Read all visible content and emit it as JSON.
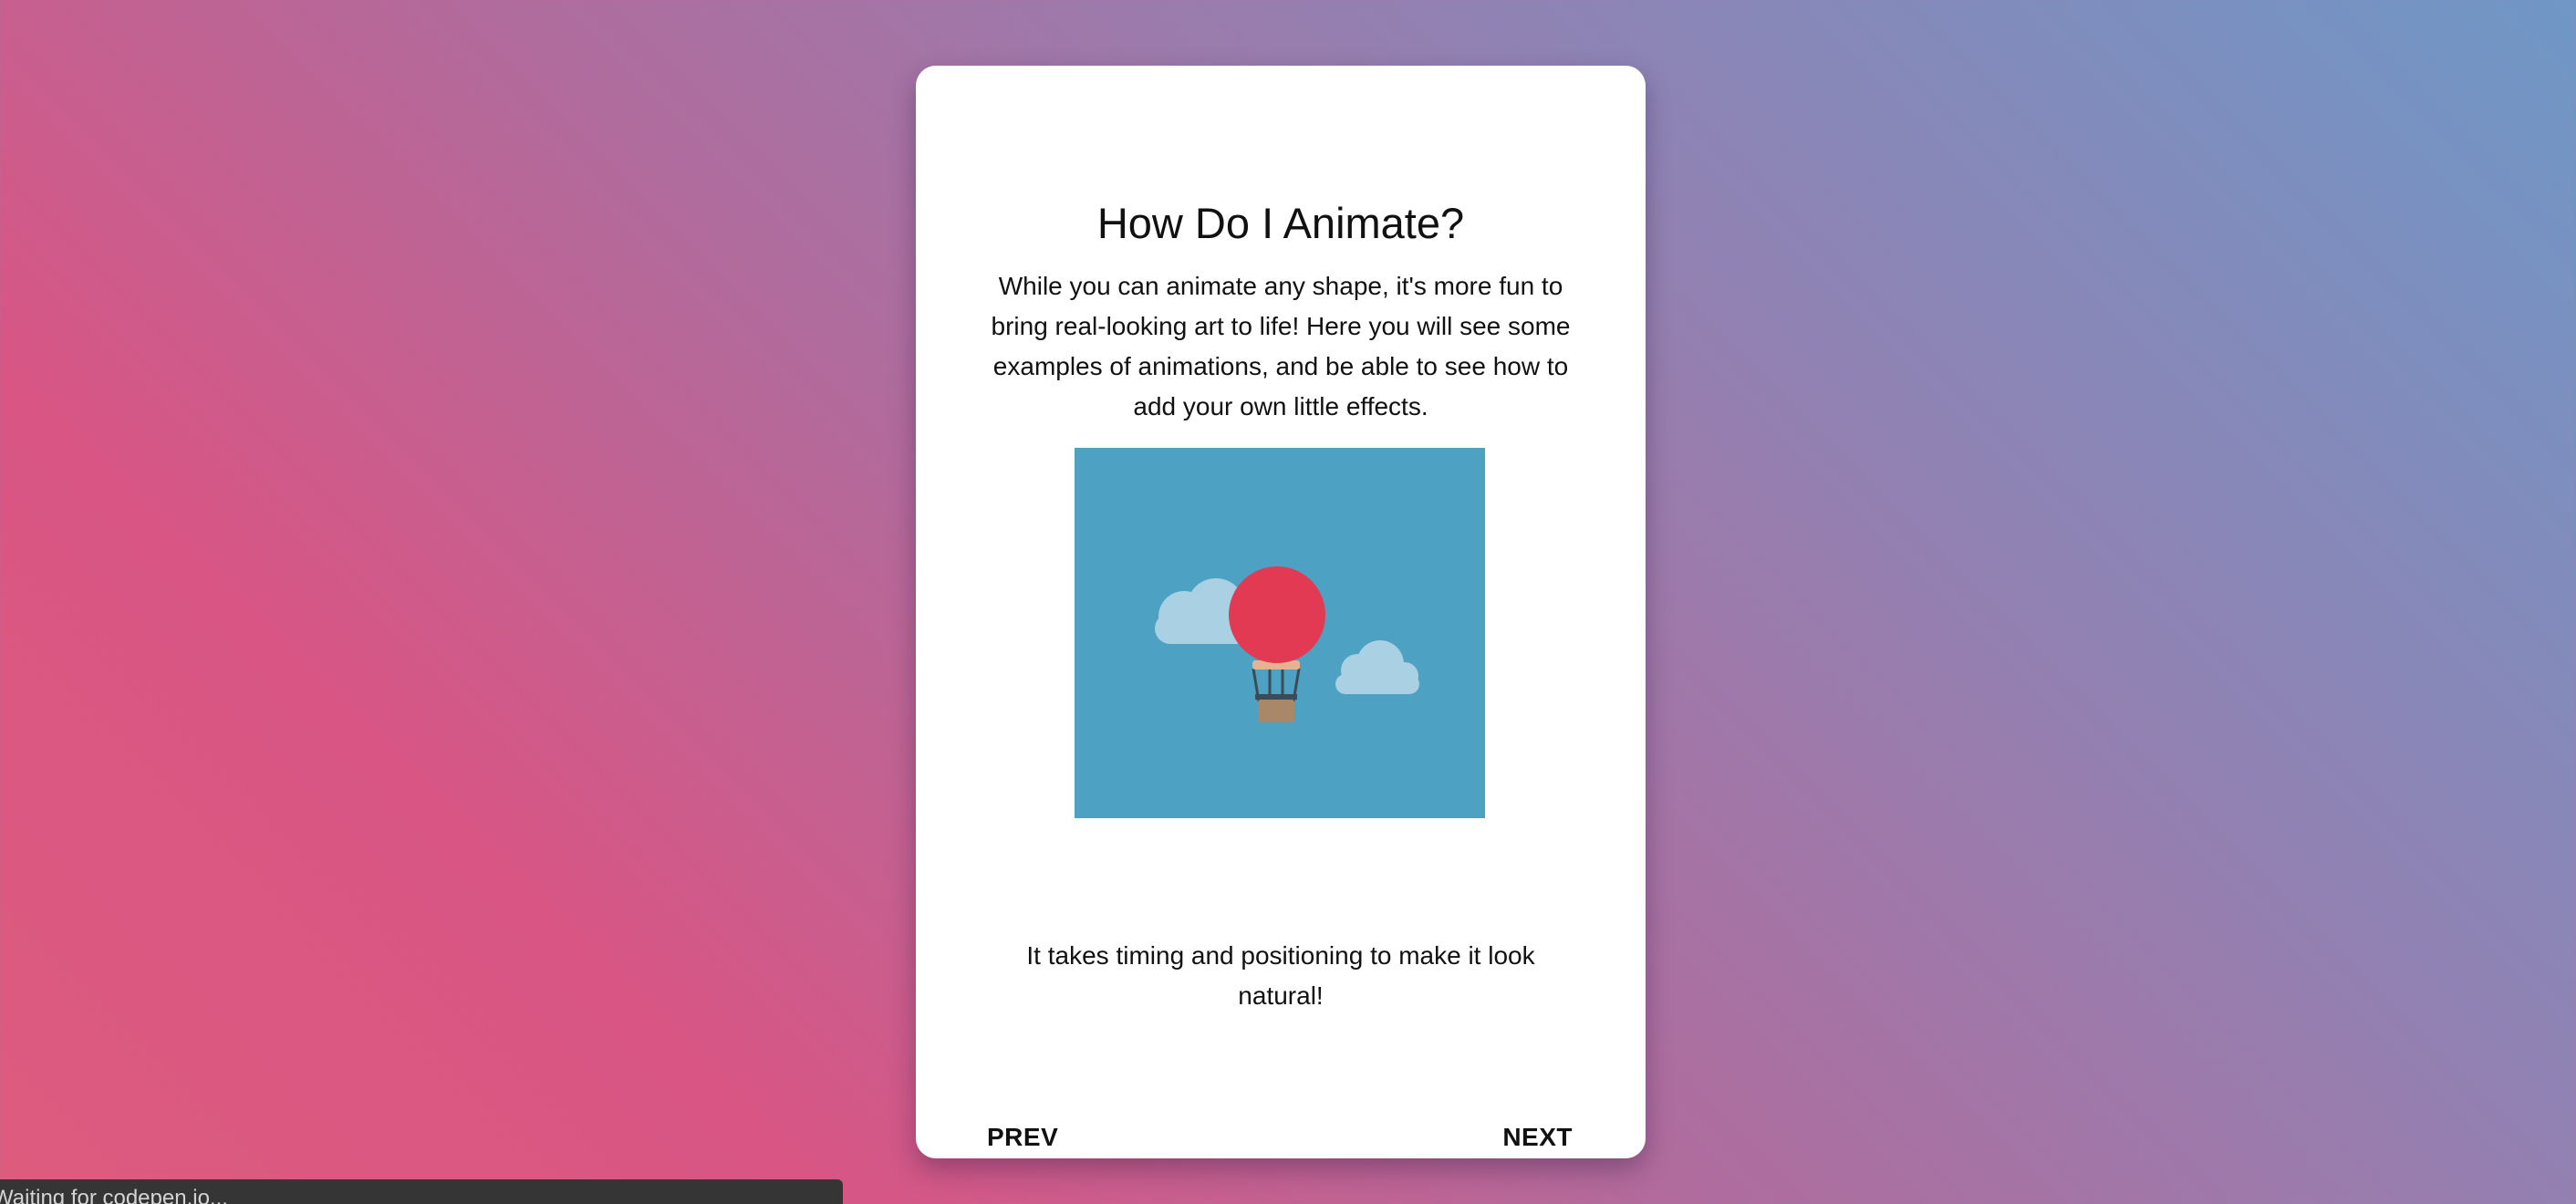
{
  "card": {
    "title": "How Do I Animate?",
    "description": "While you can animate any shape, it's more fun to bring real-looking art to life! Here you will see some examples of animations, and be able to see how to add your own little effects.",
    "illustration": {
      "subject": "hot-air-balloon",
      "colors": {
        "sky": "#4da1c2",
        "balloon": "#e23a52",
        "cloud": "#a9d1e3",
        "basket": "#a9886a",
        "band": "#e6b28f",
        "ropes": "#3c4b55"
      }
    },
    "caption": "It takes timing and positioning to make it look natural!",
    "nav": {
      "prev_label": "PREV",
      "next_label": "NEXT"
    }
  },
  "status": {
    "text": "Waiting for codepen.io..."
  }
}
